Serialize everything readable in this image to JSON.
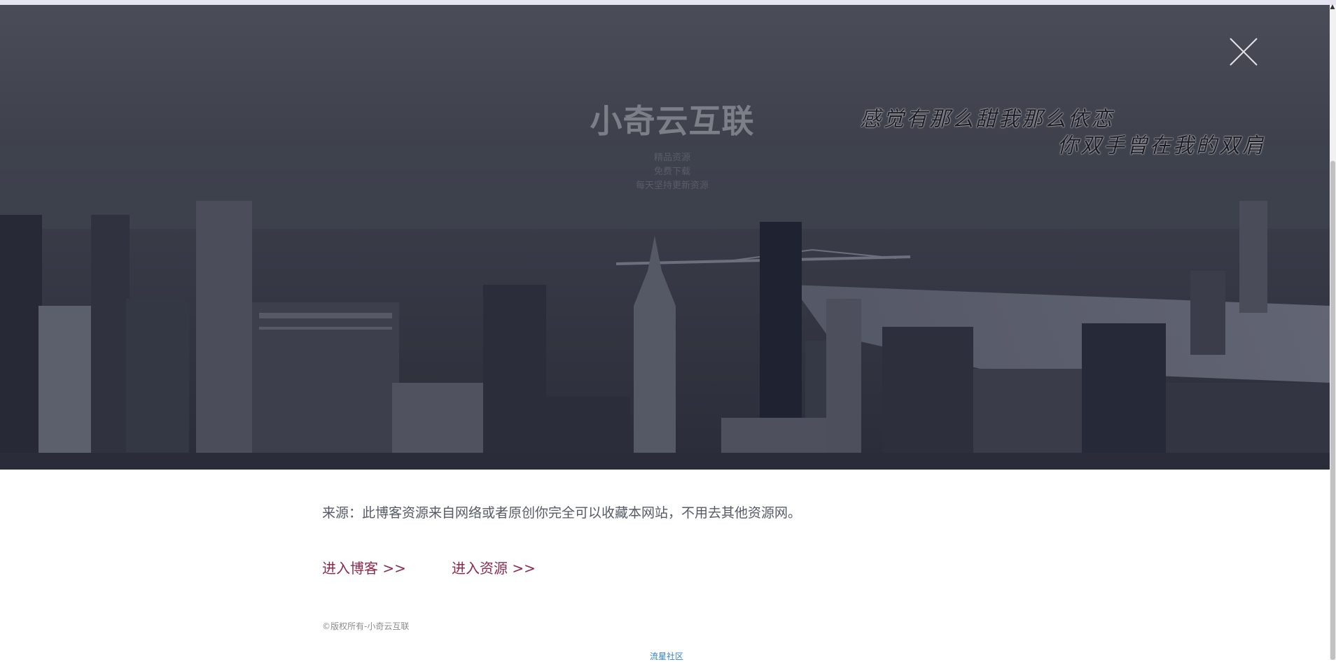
{
  "hero": {
    "site_title": "小奇云互联",
    "taglines": [
      "精品资源",
      "免费下载",
      "每天坚持更新资源"
    ],
    "lyric_line_1": "感觉有那么甜我那么依恋",
    "lyric_line_2": "你双手曾在我的双肩",
    "close_icon": "close-icon"
  },
  "content": {
    "source_text": "来源：此博客资源来自网络或者原创你完全可以收藏本网站，不用去其他资源网。",
    "blog_link": "进入博客 >>",
    "resource_link": "进入资源 >>",
    "copyright": "©版权所有-小奇云互联",
    "community_link": "流星社区"
  },
  "colors": {
    "link": "#8b2a4a",
    "community_link": "#2f7fd0",
    "hero_overlay": "#2f3240"
  }
}
